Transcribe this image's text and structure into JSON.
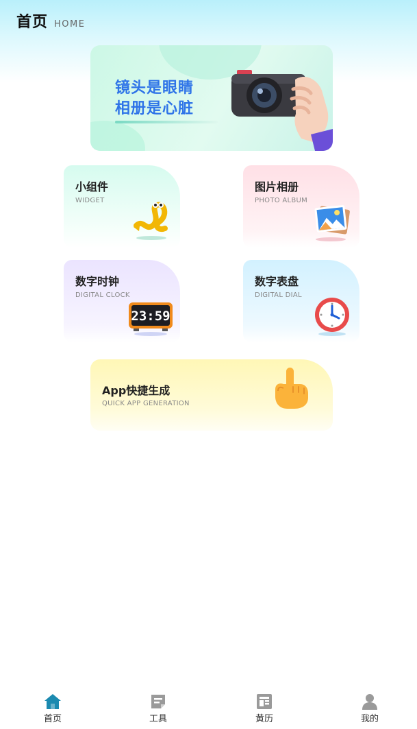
{
  "header": {
    "title": "首页",
    "subtitle": "HOME"
  },
  "banner": {
    "line1": "镜头是眼睛",
    "line2": "相册是心脏"
  },
  "cards": [
    {
      "title": "小组件",
      "subtitle": "WIDGET",
      "icon": "widget-icon"
    },
    {
      "title": "图片相册",
      "subtitle": "PHOTO ALBUM",
      "icon": "photo-album-icon"
    },
    {
      "title": "数字时钟",
      "subtitle": "DIGITAL CLOCK",
      "icon": "digital-clock-icon",
      "clock_time": "23:59"
    },
    {
      "title": "数字表盘",
      "subtitle": "DIGITAL DIAL",
      "icon": "analog-clock-icon"
    },
    {
      "title": "App快捷生成",
      "subtitle": "QUICK APP GENERATION",
      "icon": "pointing-hand-icon"
    }
  ],
  "tabbar": {
    "active_color": "#1b8ab0",
    "inactive_color": "#9a9a9a",
    "items": [
      {
        "label": "首页",
        "icon": "home-icon",
        "active": true
      },
      {
        "label": "工具",
        "icon": "tools-icon",
        "active": false
      },
      {
        "label": "黄历",
        "icon": "almanac-icon",
        "active": false
      },
      {
        "label": "我的",
        "icon": "profile-icon",
        "active": false
      }
    ]
  }
}
